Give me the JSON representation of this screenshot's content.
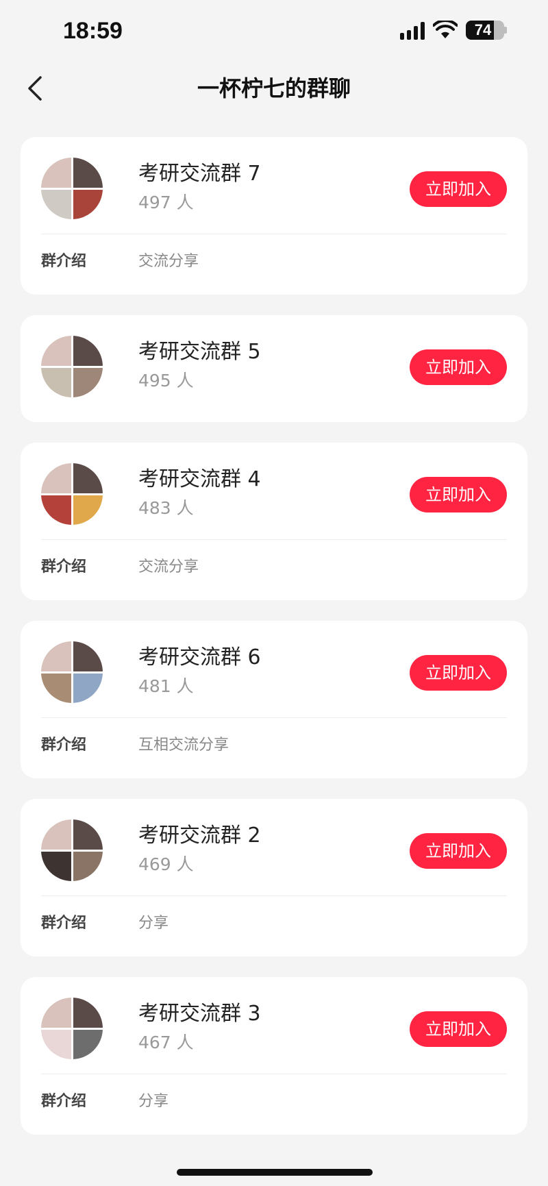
{
  "status_bar": {
    "time": "18:59",
    "battery": "74",
    "battery_level": 0.74
  },
  "header": {
    "title": "一杯柠七的群聊",
    "back_icon": "chevron-left-icon"
  },
  "colors": {
    "accent": "#ff2442",
    "background": "#f4f4f4",
    "card": "#ffffff"
  },
  "intro_label": "群介绍",
  "groups": [
    {
      "name": "考研交流群 7",
      "members": "497 人",
      "button": "立即加入",
      "intro": "交流分享",
      "avatar_colors": [
        "#d8c2bb",
        "#5a4a48",
        "#cfcac4",
        "#a8443a"
      ]
    },
    {
      "name": "考研交流群 5",
      "members": "495 人",
      "button": "立即加入",
      "intro": "",
      "avatar_colors": [
        "#d8c2bb",
        "#5a4a48",
        "#c9bfb0",
        "#9e8678"
      ]
    },
    {
      "name": "考研交流群 4",
      "members": "483 人",
      "button": "立即加入",
      "intro": "交流分享",
      "avatar_colors": [
        "#d8c2bb",
        "#5a4a48",
        "#b5423a",
        "#e0a84a"
      ]
    },
    {
      "name": "考研交流群 6",
      "members": "481 人",
      "button": "立即加入",
      "intro": "互相交流分享",
      "avatar_colors": [
        "#d8c2bb",
        "#5a4a48",
        "#a88c74",
        "#8fa6c4"
      ]
    },
    {
      "name": "考研交流群 2",
      "members": "469 人",
      "button": "立即加入",
      "intro": "分享",
      "avatar_colors": [
        "#d8c2bb",
        "#5a4a48",
        "#3d3431",
        "#8a7466"
      ]
    },
    {
      "name": "考研交流群 3",
      "members": "467 人",
      "button": "立即加入",
      "intro": "分享",
      "avatar_colors": [
        "#d8c2bb",
        "#5a4a48",
        "#e9d6d6",
        "#6d6d6d"
      ]
    }
  ]
}
